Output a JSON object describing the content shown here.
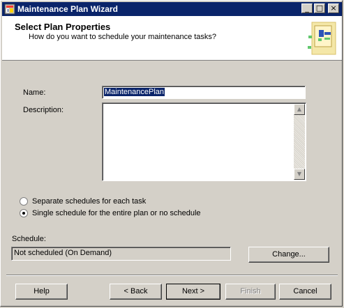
{
  "window": {
    "title": "Maintenance Plan Wizard",
    "controls": {
      "minimize": "_",
      "maximize": "□",
      "close": "×"
    }
  },
  "header": {
    "title": "Select Plan Properties",
    "subtitle": "How do you want to schedule your maintenance tasks?"
  },
  "form": {
    "name_label": "Name:",
    "name_value": "MaintenancePlan",
    "description_label": "Description:",
    "description_value": ""
  },
  "schedule_mode": {
    "option1": {
      "label": "Separate schedules for each task",
      "checked": false
    },
    "option2": {
      "label": "Single schedule for the entire plan or no schedule",
      "checked": true
    }
  },
  "schedule": {
    "label": "Schedule:",
    "value": "Not scheduled (On Demand)",
    "change_button": "Change..."
  },
  "footer": {
    "help": "Help",
    "back": "< Back",
    "next": "Next >",
    "finish": "Finish",
    "cancel": "Cancel"
  },
  "colors": {
    "title_bar": "#0a246a",
    "header_background": "#ffffff",
    "panel_background": "#d4d0c8",
    "selected_text_background": "#0a246a"
  },
  "icons": {
    "app_icon": "maintenance-plan-icon",
    "header_graphic": "wizard-header-graphic",
    "scroll_up": "scroll-up-arrow-icon",
    "scroll_down": "scroll-down-arrow-icon"
  }
}
